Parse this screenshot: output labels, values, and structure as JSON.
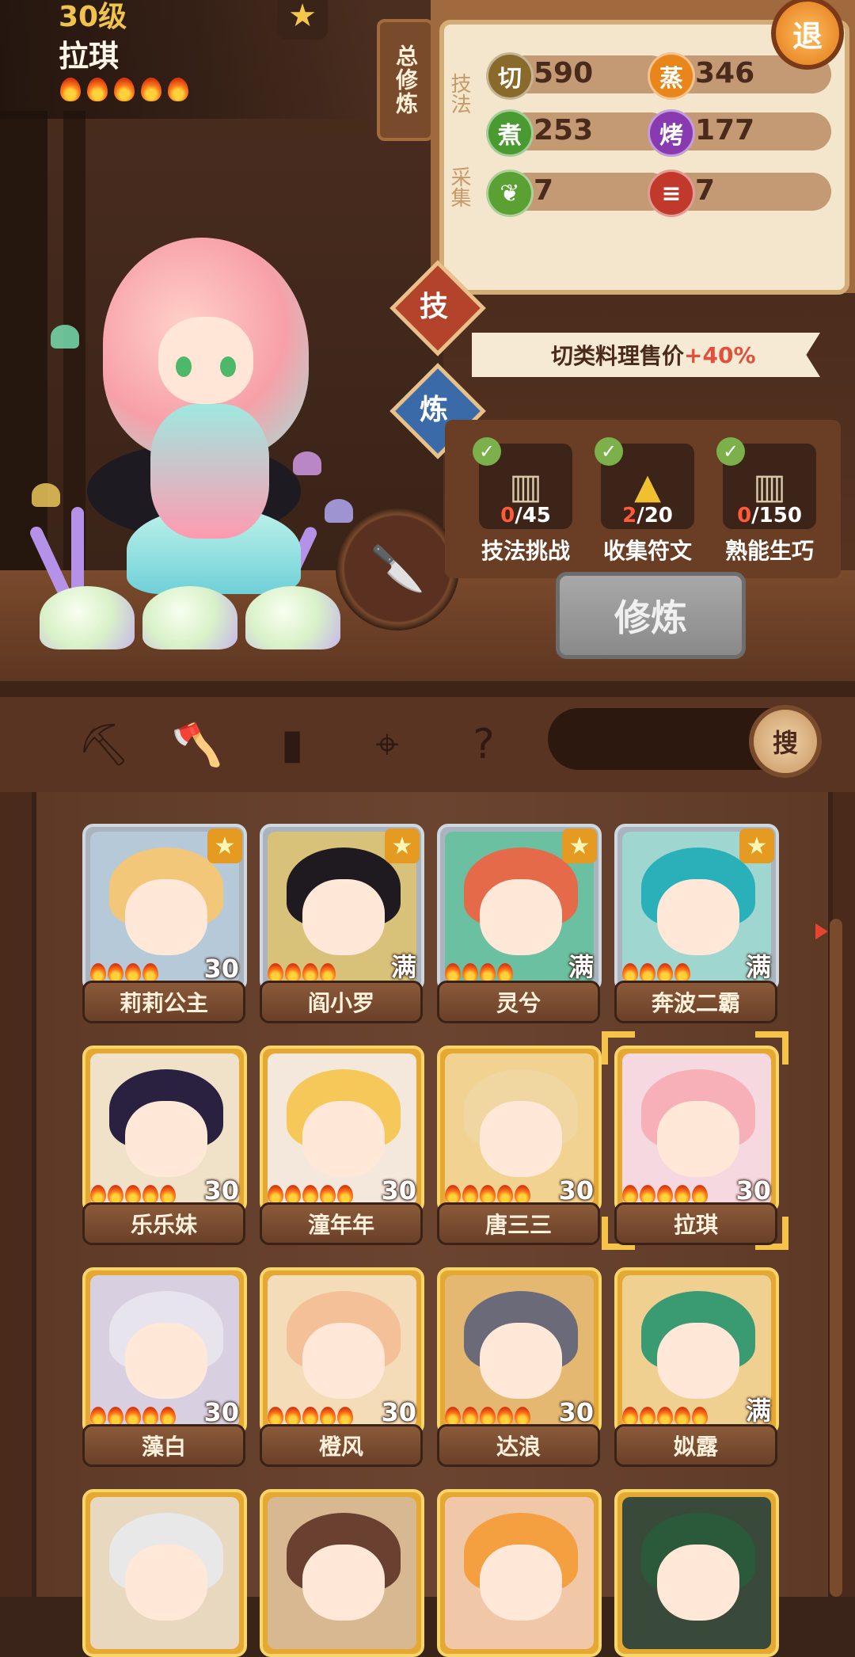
{
  "character": {
    "level": "30级",
    "name": "拉琪",
    "flames": 5
  },
  "side_tab": {
    "label": "总修炼"
  },
  "stats": {
    "section_skill_label": "技法",
    "section_gather_label": "采集",
    "skills": [
      {
        "icon": "切",
        "value": "590",
        "color": "#8a6a2a"
      },
      {
        "icon": "蒸",
        "value": "346",
        "color": "#e8861c"
      },
      {
        "icon": "煮",
        "value": "253",
        "color": "#4a9a32"
      },
      {
        "icon": "烤",
        "value": "177",
        "color": "#8a3ab0"
      }
    ],
    "gather": [
      {
        "icon": "vegetable-icon",
        "value": "7",
        "color": "#5aa032"
      },
      {
        "icon": "meat-icon",
        "value": "7",
        "color": "#c0392b"
      }
    ],
    "exit_label": "退"
  },
  "tabs": {
    "skill": "技",
    "refine": "炼"
  },
  "bonus": {
    "text": "切类料理售价",
    "plus": "+40%"
  },
  "tasks": [
    {
      "label": "技法挑战",
      "current": "0",
      "total": "/45",
      "icon": "scroll-icon"
    },
    {
      "label": "收集符文",
      "current": "2",
      "total": "/20",
      "icon": "rune-icon"
    },
    {
      "label": "熟能生巧",
      "current": "0",
      "total": "/150",
      "icon": "scroll-icon"
    }
  ],
  "train_button": "修炼",
  "search": {
    "button_label": "搜",
    "placeholder": ""
  },
  "toolbar_icons": [
    "shovel-icon",
    "hoe-icon",
    "jar-icon",
    "location-pin-icon",
    "map-help-icon"
  ],
  "roster": [
    {
      "name": "莉莉公主",
      "level": "30",
      "star": true,
      "frame": "silver",
      "flames": 4,
      "hair": "#f3c77a",
      "bg": "#b6c9d8"
    },
    {
      "name": "阎小罗",
      "level": "满",
      "star": true,
      "frame": "silver",
      "flames": 4,
      "hair": "#1f1a20",
      "bg": "#d8c27a"
    },
    {
      "name": "灵兮",
      "level": "满",
      "star": true,
      "frame": "silver",
      "flames": 4,
      "hair": "#e46a4a",
      "bg": "#6ac0a0"
    },
    {
      "name": "奔波二霸",
      "level": "满",
      "star": true,
      "frame": "silver",
      "flames": 4,
      "hair": "#2ab0b8",
      "bg": "#9fd6d0"
    },
    {
      "name": "乐乐妹",
      "level": "30",
      "star": false,
      "frame": "gold",
      "flames": 5,
      "hair": "#2a2040",
      "bg": "#f0e2c8"
    },
    {
      "name": "潼年年",
      "level": "30",
      "star": false,
      "frame": "gold",
      "flames": 5,
      "hair": "#f6c85a",
      "bg": "#f4e8dc"
    },
    {
      "name": "唐三三",
      "level": "30",
      "star": false,
      "frame": "gold",
      "flames": 5,
      "hair": "#f0d6a0",
      "bg": "#f2d290"
    },
    {
      "name": "拉琪",
      "level": "30",
      "star": false,
      "frame": "gold",
      "flames": 5,
      "hair": "#f7b0b8",
      "bg": "#f6d8e0",
      "selected": true
    },
    {
      "name": "藻白",
      "level": "30",
      "star": false,
      "frame": "gold",
      "flames": 5,
      "hair": "#e8e4ee",
      "bg": "#d8d0e0"
    },
    {
      "name": "橙风",
      "level": "30",
      "star": false,
      "frame": "gold",
      "flames": 5,
      "hair": "#f4c098",
      "bg": "#f4dcb8"
    },
    {
      "name": "达浪",
      "level": "30",
      "star": false,
      "frame": "gold",
      "flames": 5,
      "hair": "#6a6a78",
      "bg": "#e4b870"
    },
    {
      "name": "姒露",
      "level": "满",
      "star": false,
      "frame": "gold",
      "flames": 5,
      "hair": "#3a9a72",
      "bg": "#f0d090"
    },
    {
      "name": "",
      "level": "",
      "star": false,
      "frame": "gold",
      "flames": 0,
      "hair": "#e8e8e8",
      "bg": "#e8d8c0"
    },
    {
      "name": "",
      "level": "",
      "star": false,
      "frame": "gold",
      "flames": 0,
      "hair": "#6a4030",
      "bg": "#d8b890"
    },
    {
      "name": "",
      "level": "",
      "star": false,
      "frame": "gold",
      "flames": 0,
      "hair": "#f4a040",
      "bg": "#f0c8a8"
    },
    {
      "name": "",
      "level": "",
      "star": false,
      "frame": "gold",
      "flames": 0,
      "hair": "#2a5a3a",
      "bg": "#3a4a3a"
    }
  ]
}
